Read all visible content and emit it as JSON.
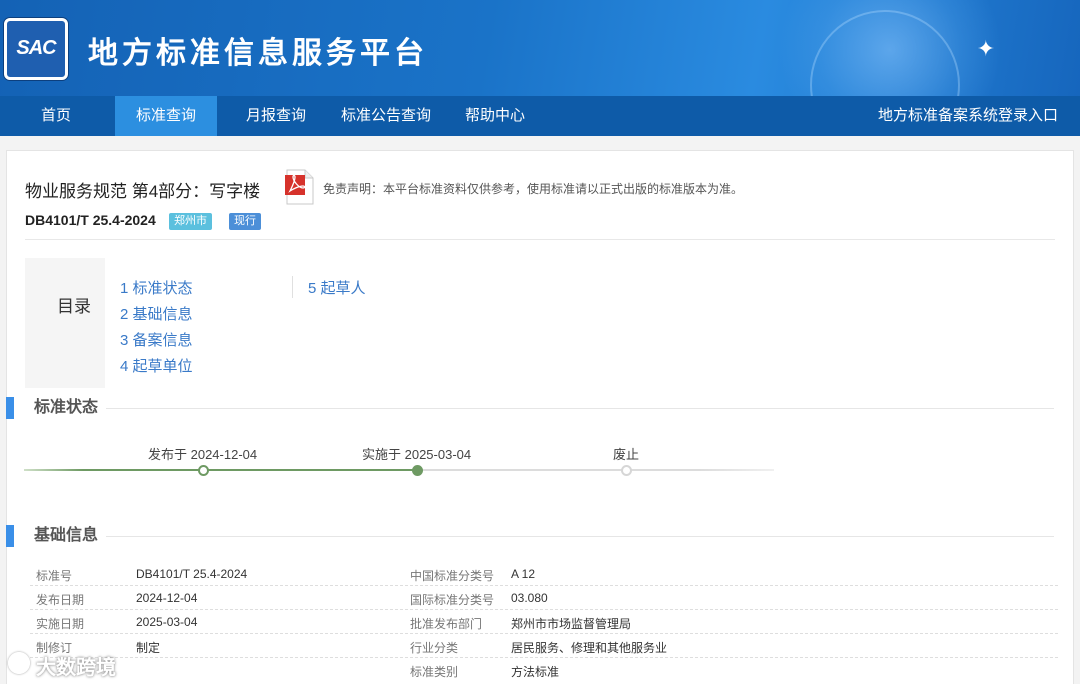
{
  "header": {
    "logo_text": "SAC",
    "site_title": "地方标准信息服务平台"
  },
  "nav": {
    "items": [
      "首页",
      "标准查询",
      "月报查询",
      "标准公告查询",
      "帮助中心"
    ],
    "active_index": 1,
    "login_link": "地方标准备案系统登录入口"
  },
  "standard": {
    "title": "物业服务规范 第4部分：写字楼",
    "disclaimer": "免责声明：本平台标准资料仅供参考，使用标准请以正式出版的标准版本为准。",
    "code": "DB4101/T 25.4-2024",
    "city_tag": "郑州市",
    "status_tag": "现行"
  },
  "toc": {
    "title": "目录",
    "items": [
      "1  标准状态",
      "2  基础信息",
      "3  备案信息",
      "4  起草单位",
      "5  起草人"
    ]
  },
  "sections": {
    "status": "标准状态",
    "basic": "基础信息"
  },
  "timeline": {
    "published": "发布于 2024-12-04",
    "implemented": "实施于 2025-03-04",
    "abolished": "废止",
    "completed_steps": 2,
    "total_steps": 3
  },
  "basic_info": {
    "rows": [
      {
        "label1": "标准号",
        "value1": "DB4101/T 25.4-2024",
        "label2": "中国标准分类号",
        "value2": "A 12"
      },
      {
        "label1": "发布日期",
        "value1": "2024-12-04",
        "label2": "国际标准分类号",
        "value2": "03.080"
      },
      {
        "label1": "实施日期",
        "value1": "2025-03-04",
        "label2": "批准发布部门",
        "value2": "郑州市市场监督管理局"
      },
      {
        "label1": "制修订",
        "value1": "制定",
        "label2": "行业分类",
        "value2": "居民服务、修理和其他服务业"
      },
      {
        "label1": "",
        "value1": "",
        "label2": "标准类别",
        "value2": "方法标准"
      }
    ]
  },
  "watermark": "大数跨境",
  "colors": {
    "banner": "#1a73c8",
    "nav": "#0e5ba8",
    "nav_active": "#2c8fe0",
    "accent": "#3a8fe8",
    "link": "#3a7ac8",
    "timeline_done": "#6e9a63"
  }
}
